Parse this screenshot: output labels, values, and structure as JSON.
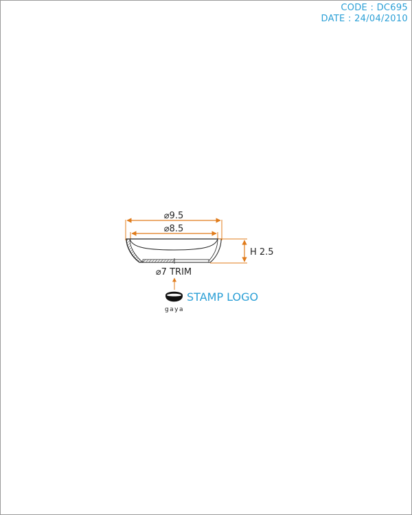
{
  "header": {
    "code_line": "CODE : DC695",
    "date_line": "DATE : 24/04/2010"
  },
  "dimensions": {
    "outer_diameter": "⌀9.5",
    "inner_diameter": "⌀8.5",
    "height": "H 2.5",
    "trim": "⌀7 TRIM"
  },
  "stamp": {
    "label": "STAMP LOGO",
    "logo_text": "gaya"
  },
  "colors": {
    "frame": "#9a9a9a",
    "dimension_line": "#e07b1a",
    "accent_text": "#2a9fd6",
    "outline": "#222222"
  }
}
